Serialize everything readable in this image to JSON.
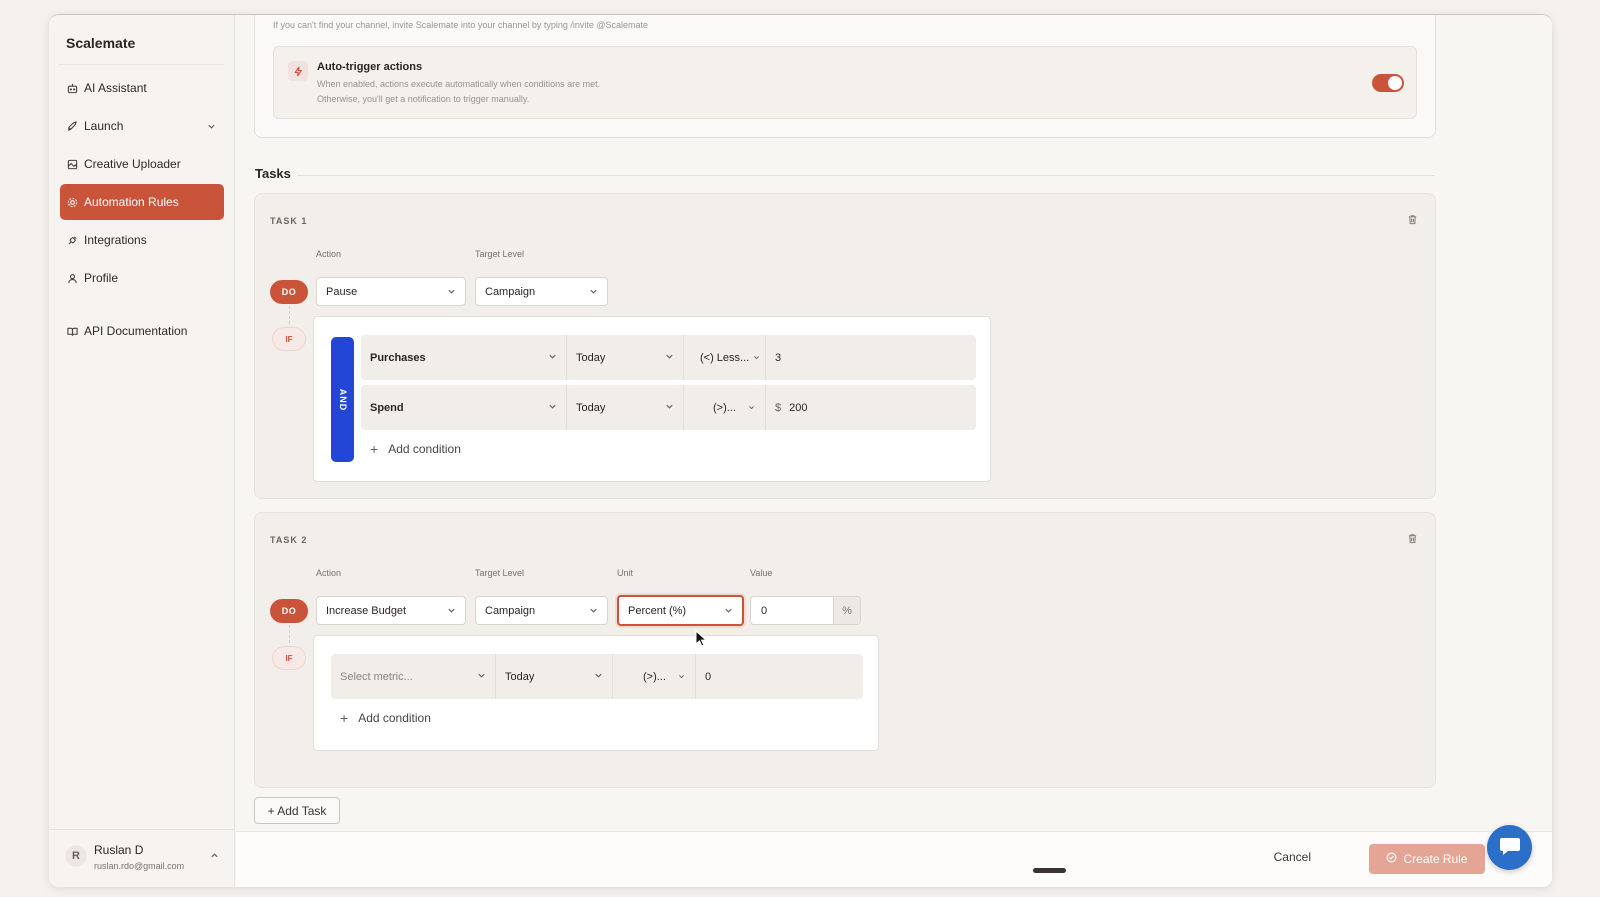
{
  "brand": "Scalemate",
  "sidebar": {
    "items": [
      {
        "label": "AI Assistant",
        "icon": "bot-icon"
      },
      {
        "label": "Launch",
        "icon": "rocket-icon"
      },
      {
        "label": "Creative Uploader",
        "icon": "image-icon"
      },
      {
        "label": "Automation Rules",
        "icon": "settings-icon",
        "active": true
      },
      {
        "label": "Integrations",
        "icon": "plug-icon"
      },
      {
        "label": "Profile",
        "icon": "user-icon"
      },
      {
        "label": "API Documentation",
        "icon": "book-icon"
      }
    ],
    "user": {
      "initial": "R",
      "name": "Ruslan D",
      "email": "ruslan.rdo@gmail.com"
    }
  },
  "hint": "If you can't find your channel, invite Scalemate into your channel by typing /invite @Scalemate",
  "auto_trigger": {
    "title": "Auto-trigger actions",
    "desc_line1": "When enabled, actions execute automatically when conditions are met.",
    "desc_line2": "Otherwise, you'll get a notification to trigger manually.",
    "enabled": true
  },
  "tasks_heading": "Tasks",
  "labels": {
    "action": "Action",
    "target_level": "Target Level",
    "unit": "Unit",
    "value": "Value",
    "do": "DO",
    "if": "IF",
    "and": "AND",
    "add_condition": "Add condition"
  },
  "task1": {
    "label": "TASK 1",
    "action": "Pause",
    "target_level": "Campaign",
    "conditions": [
      {
        "metric": "Purchases",
        "period": "Today",
        "operator": "(<) Less...",
        "prefix": "",
        "value": "3"
      },
      {
        "metric": "Spend",
        "period": "Today",
        "operator": "(>)...",
        "prefix": "$",
        "value": "200"
      }
    ]
  },
  "task2": {
    "label": "TASK 2",
    "action": "Increase Budget",
    "target_level": "Campaign",
    "unit": "Percent (%)",
    "value": "0",
    "value_suffix": "%",
    "conditions": [
      {
        "metric": "Select metric...",
        "period": "Today",
        "operator": "(>)...",
        "value": "0"
      }
    ]
  },
  "add_task": "+ Add Task",
  "footer": {
    "cancel": "Cancel",
    "create": "Create Rule"
  },
  "colors": {
    "accent": "#c9543a",
    "and_bar": "#2446d6",
    "chat": "#2b6fc9"
  }
}
